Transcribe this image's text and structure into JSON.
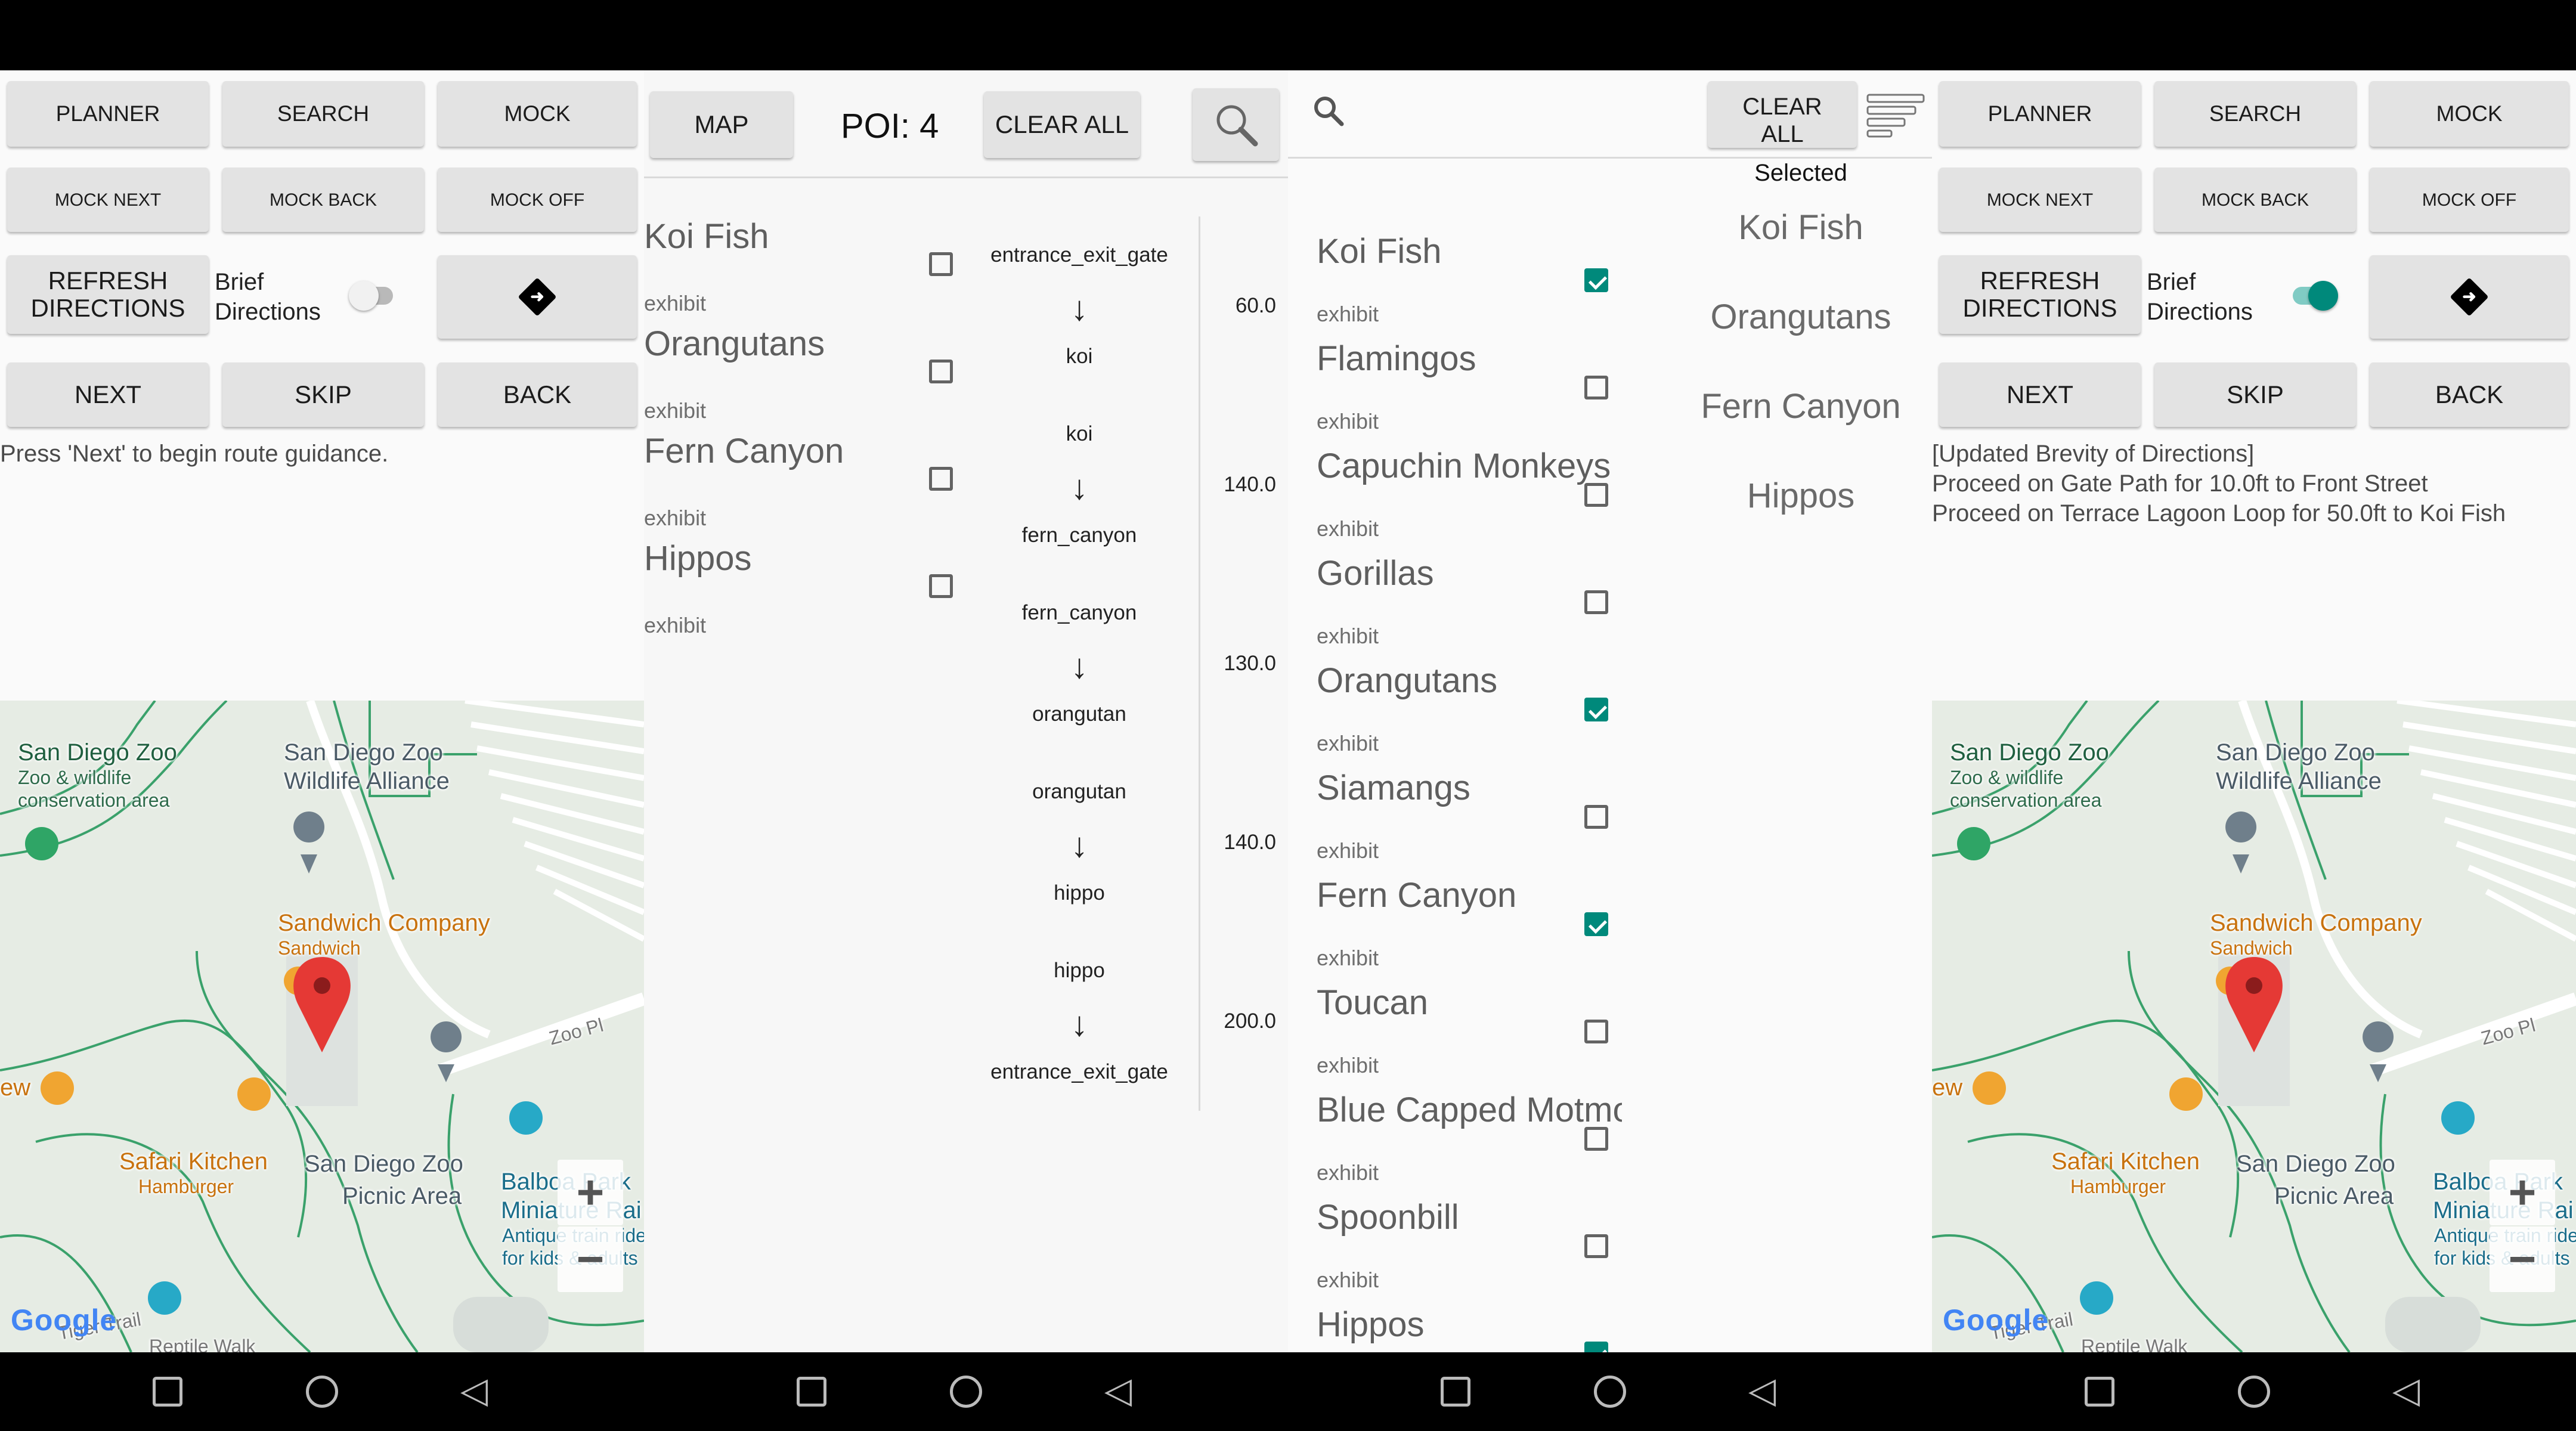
{
  "app": {
    "buttons_row1": [
      "PLANNER",
      "SEARCH",
      "MOCK"
    ],
    "buttons_row2": [
      "MOCK NEXT",
      "MOCK BACK",
      "MOCK OFF"
    ],
    "refresh": "REFRESH DIRECTIONS",
    "brief": "Brief Directions",
    "buttons_row4": [
      "NEXT",
      "SKIP",
      "BACK"
    ]
  },
  "panel1": {
    "brief_on": false,
    "guidance": "Press 'Next' to begin route guidance."
  },
  "panel4": {
    "brief_on": true,
    "guidance": [
      "[Updated Brevity of Directions]",
      "Proceed on Gate Path for 10.0ft to Front Street",
      "Proceed on Terrace Lagoon Loop for 50.0ft to Koi Fish"
    ]
  },
  "map": {
    "labels": [
      {
        "text": "San Diego Zoo",
        "color": "#1f5f3f",
        "cls": ""
      },
      {
        "text": "Zoo & wildlife",
        "color": "#2e6b4b",
        "cls": "small"
      },
      {
        "text": "conservation area",
        "color": "#2e6b4b",
        "cls": "small"
      },
      {
        "text": "San Diego Zoo",
        "color": "#4a5a66",
        "cls": ""
      },
      {
        "text": "Wildlife Alliance",
        "color": "#4a5a66",
        "cls": ""
      },
      {
        "text": "Sandwich Company",
        "color": "#c8720e",
        "cls": ""
      },
      {
        "text": "Sandwich",
        "color": "#c8720e",
        "cls": "small"
      },
      {
        "text": "ew",
        "color": "#c8720e",
        "cls": ""
      },
      {
        "text": "Zoo Pl",
        "color": "#777777",
        "cls": "small"
      },
      {
        "text": "Safari Kitchen",
        "color": "#c8720e",
        "cls": ""
      },
      {
        "text": "Hamburger",
        "color": "#c8720e",
        "cls": "small"
      },
      {
        "text": "San Diego Zoo",
        "color": "#4a5a66",
        "cls": ""
      },
      {
        "text": "Picnic Area",
        "color": "#4a5a66",
        "cls": ""
      },
      {
        "text": "Balboa Park",
        "color": "#1a6d8a",
        "cls": ""
      },
      {
        "text": "Miniature Rai",
        "color": "#1a6d8a",
        "cls": ""
      },
      {
        "text": "Antique train ride",
        "color": "#1a6d8a",
        "cls": "small"
      },
      {
        "text": "for kids & adults",
        "color": "#1a6d8a",
        "cls": "small"
      },
      {
        "text": "Tiger Trail",
        "color": "#777777",
        "cls": "small"
      },
      {
        "text": "Reptile Walk",
        "color": "#777777",
        "cls": "small"
      }
    ],
    "zoom_in": "+",
    "zoom_out": "−",
    "logo": "Google"
  },
  "panel2": {
    "map_button": "MAP",
    "poi": "POI: 4",
    "clear_all": "CLEAR ALL",
    "exhibits": [
      {
        "name": "Koi Fish",
        "kind": "exhibit"
      },
      {
        "name": "Orangutans",
        "kind": "exhibit"
      },
      {
        "name": "Fern Canyon",
        "kind": "exhibit"
      },
      {
        "name": "Hippos",
        "kind": "exhibit"
      }
    ],
    "route": [
      {
        "from": "entrance_exit_gate",
        "to": "koi",
        "distance": "60.0"
      },
      {
        "from": "koi",
        "to": "fern_canyon",
        "distance": "140.0"
      },
      {
        "from": "fern_canyon",
        "to": "orangutan",
        "distance": "130.0"
      },
      {
        "from": "orangutan",
        "to": "hippo",
        "distance": "140.0"
      },
      {
        "from": "hippo",
        "to": "entrance_exit_gate",
        "distance": "200.0"
      }
    ],
    "arrow": "↓"
  },
  "panel3": {
    "clear_all": "CLEAR ALL",
    "selected_header": "Selected",
    "exhibits": [
      {
        "name": "Koi Fish",
        "kind": "exhibit",
        "checked": true
      },
      {
        "name": "Flamingos",
        "kind": "exhibit",
        "checked": false
      },
      {
        "name": "Capuchin Monkeys",
        "kind": "exhibit",
        "checked": false
      },
      {
        "name": "Gorillas",
        "kind": "exhibit",
        "checked": false
      },
      {
        "name": "Orangutans",
        "kind": "exhibit",
        "checked": true
      },
      {
        "name": "Siamangs",
        "kind": "exhibit",
        "checked": false
      },
      {
        "name": "Fern Canyon",
        "kind": "exhibit",
        "checked": true
      },
      {
        "name": "Toucan",
        "kind": "exhibit",
        "checked": false
      },
      {
        "name": "Blue Capped Motmot",
        "kind": "exhibit",
        "checked": false
      },
      {
        "name": "Spoonbill",
        "kind": "exhibit",
        "checked": false
      },
      {
        "name": "Hippos",
        "kind": "exhibit",
        "checked": true
      }
    ],
    "selected": [
      "Koi Fish",
      "Orangutans",
      "Fern Canyon",
      "Hippos"
    ]
  },
  "colors": {
    "accent": "#00897b",
    "button_bg": "#e3e3e3",
    "pin_red": "#e53935",
    "road": "#ffffff",
    "park_line": "#3aa16b"
  }
}
